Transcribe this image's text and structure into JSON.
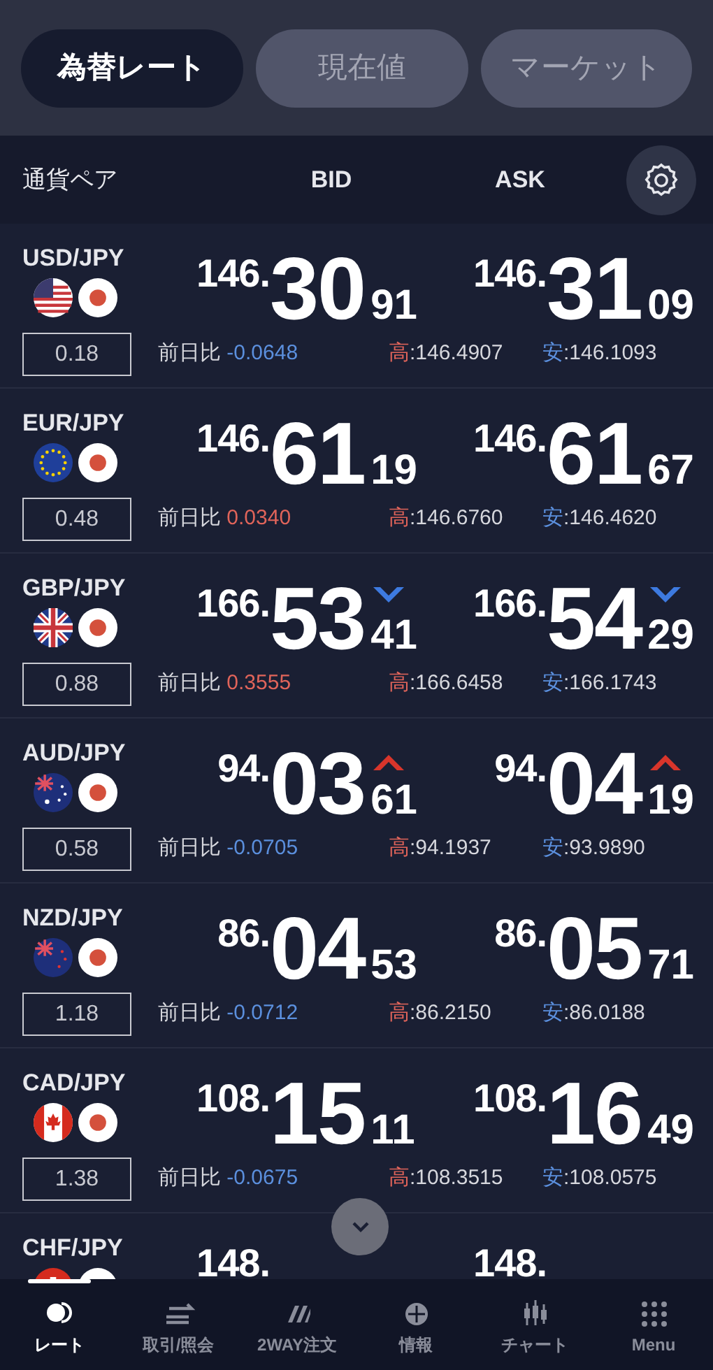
{
  "tabs": [
    {
      "label": "為替レート",
      "selected": true
    },
    {
      "label": "現在値",
      "selected": false
    },
    {
      "label": "マーケット",
      "selected": false
    }
  ],
  "header": {
    "pair": "通貨ペア",
    "bid": "BID",
    "ask": "ASK"
  },
  "rows": [
    {
      "pair": "USD/JPY",
      "spread": "0.18",
      "bid": {
        "prefix": "146.",
        "big": "30",
        "small": "91",
        "up_arrow": false,
        "down_arrow": false
      },
      "ask": {
        "prefix": "146.",
        "big": "31",
        "small": "09",
        "up_arrow": false,
        "down_arrow": false
      },
      "change_label": "前日比",
      "change": "-0.0648",
      "change_negative": true,
      "high_label": "高",
      "high": ":146.4907",
      "low_label": "安",
      "low": ":146.1093"
    },
    {
      "pair": "EUR/JPY",
      "spread": "0.48",
      "bid": {
        "prefix": "146.",
        "big": "61",
        "small": "19",
        "up_arrow": false,
        "down_arrow": false
      },
      "ask": {
        "prefix": "146.",
        "big": "61",
        "small": "67",
        "up_arrow": false,
        "down_arrow": false
      },
      "change_label": "前日比",
      "change": "0.0340",
      "change_negative": false,
      "high_label": "高",
      "high": ":146.6760",
      "low_label": "安",
      "low": ":146.4620"
    },
    {
      "pair": "GBP/JPY",
      "spread": "0.88",
      "bid": {
        "prefix": "166.",
        "big": "53",
        "small": "41",
        "up_arrow": false,
        "down_arrow": true
      },
      "ask": {
        "prefix": "166.",
        "big": "54",
        "small": "29",
        "up_arrow": false,
        "down_arrow": true
      },
      "change_label": "前日比",
      "change": "0.3555",
      "change_negative": false,
      "high_label": "高",
      "high": ":166.6458",
      "low_label": "安",
      "low": ":166.1743"
    },
    {
      "pair": "AUD/JPY",
      "spread": "0.58",
      "bid": {
        "prefix": "94.",
        "big": "03",
        "small": "61",
        "up_arrow": true,
        "down_arrow": false
      },
      "ask": {
        "prefix": "94.",
        "big": "04",
        "small": "19",
        "up_arrow": true,
        "down_arrow": false
      },
      "change_label": "前日比",
      "change": "-0.0705",
      "change_negative": true,
      "high_label": "高",
      "high": ":94.1937",
      "low_label": "安",
      "low": ":93.9890"
    },
    {
      "pair": "NZD/JPY",
      "spread": "1.18",
      "bid": {
        "prefix": "86.",
        "big": "04",
        "small": "53",
        "up_arrow": false,
        "down_arrow": false
      },
      "ask": {
        "prefix": "86.",
        "big": "05",
        "small": "71",
        "up_arrow": false,
        "down_arrow": false
      },
      "change_label": "前日比",
      "change": "-0.0712",
      "change_negative": true,
      "high_label": "高",
      "high": ":86.2150",
      "low_label": "安",
      "low": ":86.0188"
    },
    {
      "pair": "CAD/JPY",
      "spread": "1.38",
      "bid": {
        "prefix": "108.",
        "big": "15",
        "small": "11",
        "up_arrow": false,
        "down_arrow": false
      },
      "ask": {
        "prefix": "108.",
        "big": "16",
        "small": "49",
        "up_arrow": false,
        "down_arrow": false
      },
      "change_label": "前日比",
      "change": "-0.0675",
      "change_negative": true,
      "high_label": "高",
      "high": ":108.3515",
      "low_label": "安",
      "low": ":108.0575"
    },
    {
      "pair": "CHF/JPY",
      "bid": {
        "prefix": "148."
      },
      "ask": {
        "prefix": "148."
      }
    }
  ],
  "nav": [
    {
      "label": "レート",
      "selected": true
    },
    {
      "label": "取引/照会",
      "selected": false
    },
    {
      "label": "2WAY注文",
      "selected": false
    },
    {
      "label": "情報",
      "selected": false
    },
    {
      "label": "チャート",
      "selected": false
    },
    {
      "label": "Menu",
      "selected": false
    }
  ]
}
